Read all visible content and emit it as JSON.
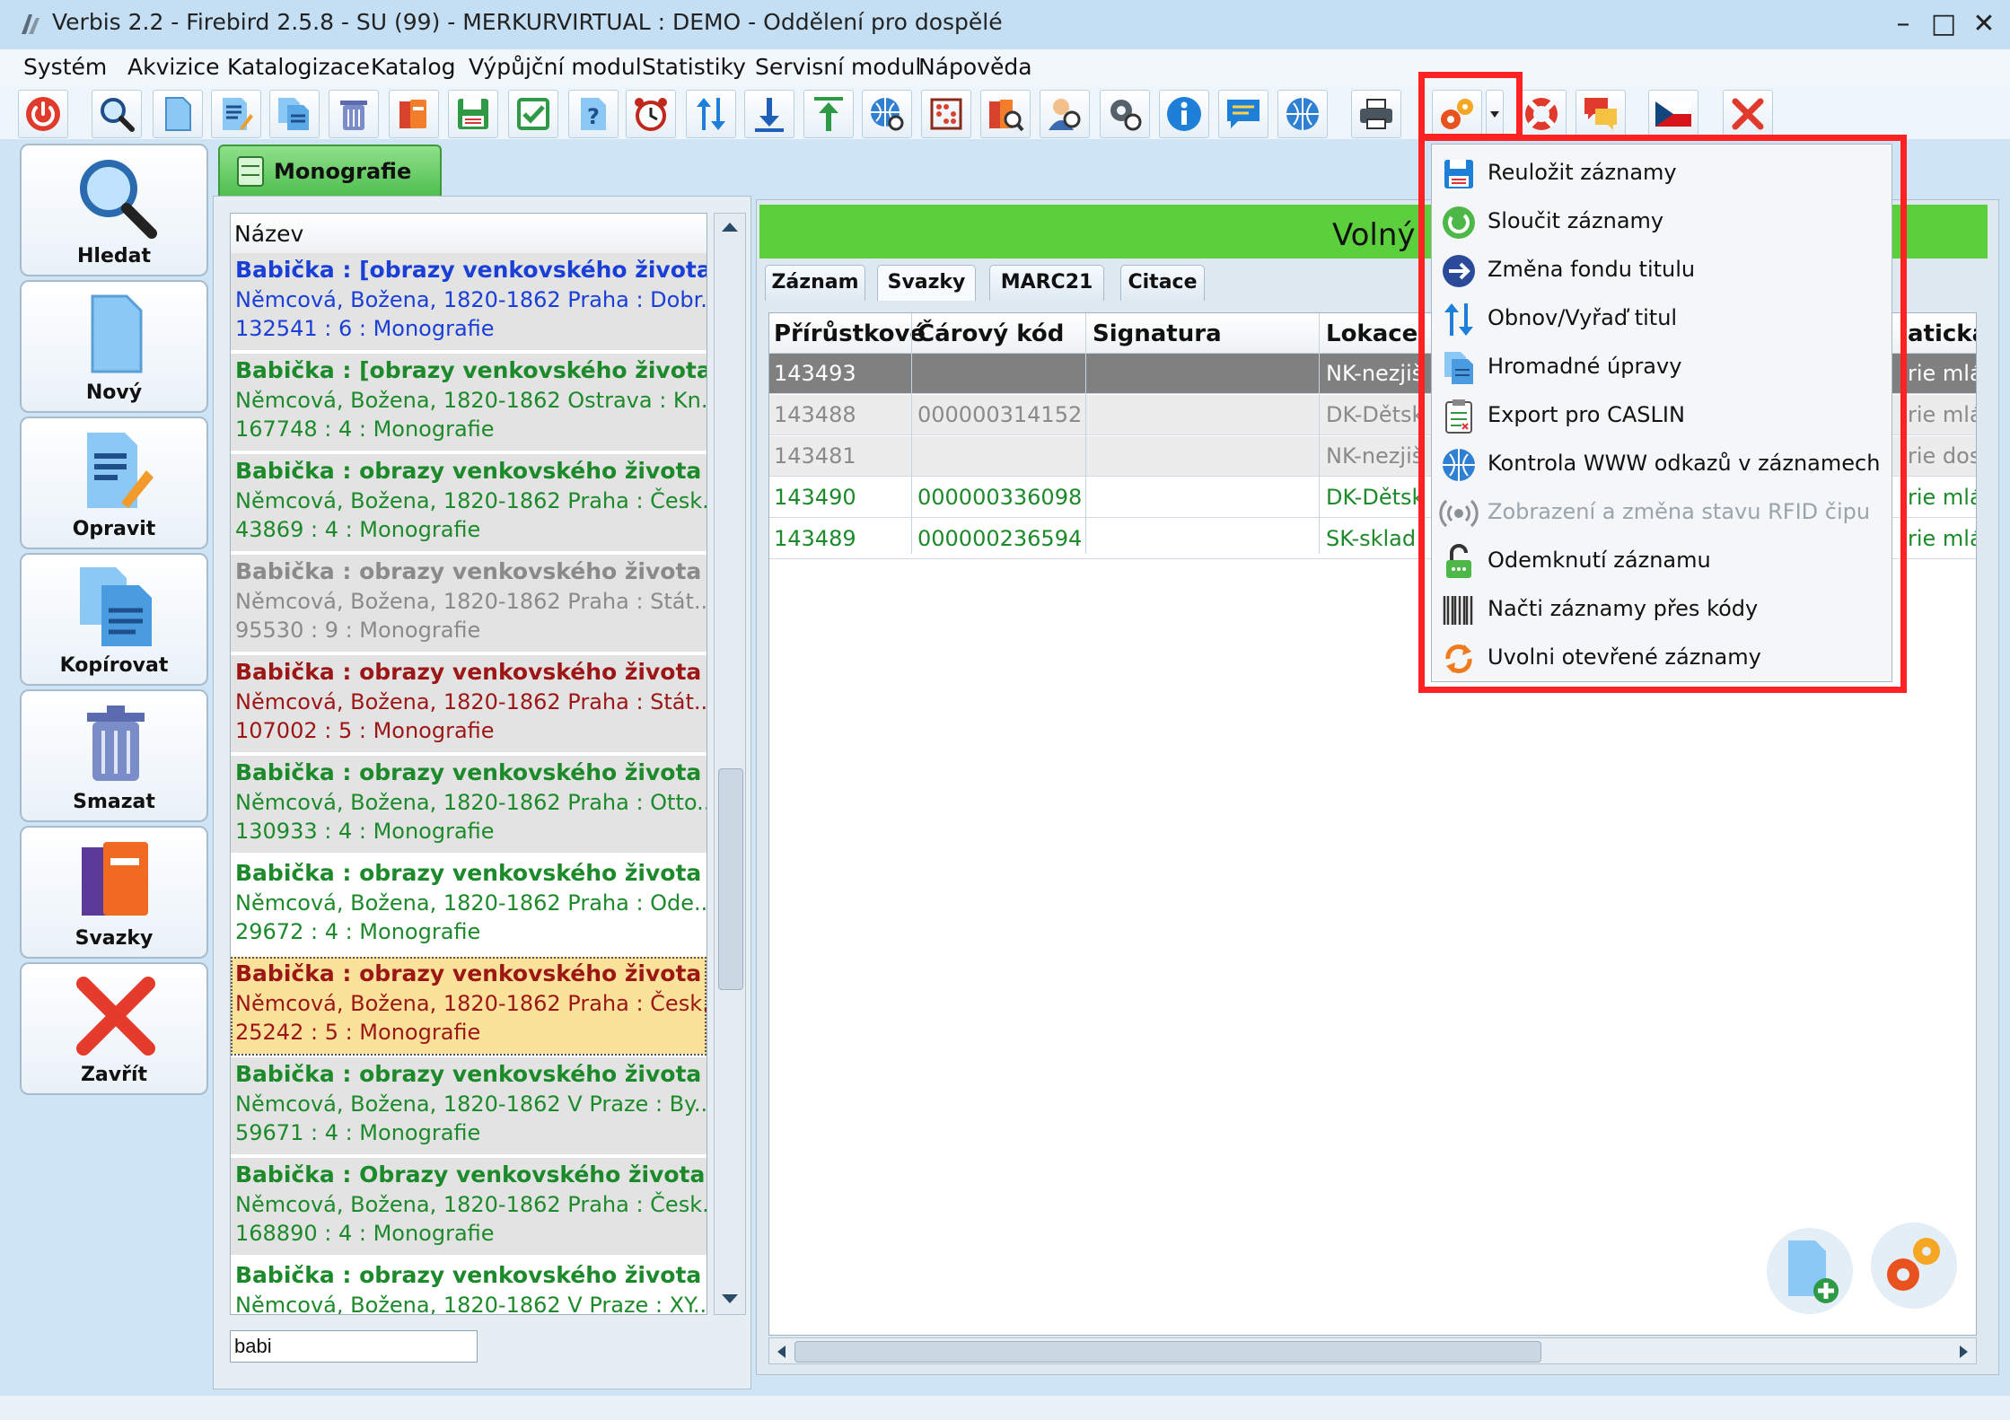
{
  "window": {
    "title": "Verbis 2.2 - Firebird 2.5.8 - SU (99) - MERKURVIRTUAL : DEMO - Oddělení pro dospělé",
    "controls": [
      "–",
      "□",
      "✕"
    ]
  },
  "menu": [
    "Systém",
    "Akvizice",
    "Katalogizace",
    "Katalog",
    "Výpůjční modul",
    "Statistiky",
    "Servisní modul",
    "Nápověda"
  ],
  "toolbar_icons": [
    "power-icon",
    "search-icon",
    "new-document-icon",
    "edit-document-icon",
    "copy-document-icon",
    "trash-icon",
    "books-icon",
    "save-icon",
    "checklist-icon",
    "help-document-icon",
    "alarm-clock-icon",
    "sort-arrows-icon",
    "download-icon",
    "upload-icon",
    "globe-search-icon",
    "abacus-icon",
    "book-search-icon",
    "user-search-icon",
    "gear-search-icon",
    "info-icon",
    "message-icon",
    "globe-icon",
    "printer-icon",
    "gears-icon",
    "dropdown-arrow-icon",
    "lifebuoy-icon",
    "chat-icon",
    "czech-flag-icon",
    "close-icon"
  ],
  "sidebar": [
    {
      "label": "Hledat",
      "icon": "search-icon"
    },
    {
      "label": "Nový",
      "icon": "new-document-icon"
    },
    {
      "label": "Opravit",
      "icon": "edit-document-icon"
    },
    {
      "label": "Kopírovat",
      "icon": "copy-document-icon"
    },
    {
      "label": "Smazat",
      "icon": "trash-icon"
    },
    {
      "label": "Svazky",
      "icon": "books-icon"
    },
    {
      "label": "Zavřít",
      "icon": "close-icon"
    }
  ],
  "module_tab": "Monografie",
  "list": {
    "header": "Název",
    "search_value": "babi",
    "records": [
      {
        "title": "Babička : [obrazy venkovského života...",
        "line2": "Němcová, Božena, 1820-1862 Praha : Dobr...",
        "line3": "132541 : 6 : Monografie",
        "color": "#1a3fd6",
        "bg": "#e3e3e3"
      },
      {
        "title": "Babička : [obrazy venkovského života...",
        "line2": "Němcová, Božena, 1820-1862 Ostrava : Kn...",
        "line3": "167748 : 4 : Monografie",
        "color": "#1c8a2a",
        "bg": "#e3e3e3"
      },
      {
        "title": "Babička : obrazy venkovského života ...",
        "line2": "Němcová, Božena, 1820-1862 Praha : Česk...",
        "line3": "43869 : 4 : Monografie",
        "color": "#1c8a2a",
        "bg": "#e3e3e3"
      },
      {
        "title": "Babička : obrazy venkovského života ...",
        "line2": "Němcová, Božena, 1820-1862 Praha : Stát...",
        "line3": "95530 : 9 : Monografie",
        "color": "#8a8a8a",
        "bg": "#e3e3e3"
      },
      {
        "title": "Babička : obrazy venkovského života ...",
        "line2": "Němcová, Božena, 1820-1862 Praha : Stát...",
        "line3": "107002 : 5 : Monografie",
        "color": "#9c1616",
        "bg": "#e3e3e3"
      },
      {
        "title": "Babička : obrazy venkovského života ...",
        "line2": "Němcová, Božena, 1820-1862 Praha : Otto...",
        "line3": "130933 : 4 : Monografie",
        "color": "#1c8a2a",
        "bg": "#e3e3e3"
      },
      {
        "title": "Babička : obrazy venkovského života ...",
        "line2": "Němcová, Božena, 1820-1862 Praha : Ode...",
        "line3": "29672 : 4 : Monografie",
        "color": "#1c8a2a",
        "bg": "#ffffff"
      },
      {
        "title": "Babička : obrazy venkovského života ...",
        "line2": "Němcová, Božena, 1820-1862 Praha : Česk...",
        "line3": "25242 : 5 : Monografie",
        "color": "#9c1616",
        "bg": "#fbe29a"
      },
      {
        "title": "Babička : obrazy venkovského života ...",
        "line2": "Němcová, Božena, 1820-1862 V Praze : By...",
        "line3": "59671 : 4 : Monografie",
        "color": "#1c8a2a",
        "bg": "#e3e3e3"
      },
      {
        "title": "Babička : Obrazy venkovského života ...",
        "line2": "Němcová, Božena, 1820-1862 Praha : Česk...",
        "line3": "168890 : 4 : Monografie",
        "color": "#1c8a2a",
        "bg": "#e3e3e3"
      },
      {
        "title": "Babička : obrazy venkovského života ...",
        "line2": "Němcová, Božena, 1820-1862 V Praze : XY...",
        "line3": "",
        "color": "#1c8a2a",
        "bg": "#ffffff"
      }
    ]
  },
  "detail": {
    "status": "Volný",
    "tabs": [
      "Záznam",
      "Svazky",
      "MARC21",
      "Citace"
    ],
    "columns": [
      "Přírůstkové",
      "Čárový kód",
      "Signatura",
      "Lokace",
      "atická"
    ],
    "rows": [
      {
        "acc": "143493",
        "barcode": "",
        "sig": "",
        "loc": "NK-nezjiš",
        "cat": "rie mlá",
        "color": "#ffffff",
        "bg": "#808080"
      },
      {
        "acc": "143488",
        "barcode": "000000314152",
        "sig": "",
        "loc": "DK-Dětsk",
        "cat": "rie mlá",
        "color": "#8a8a8a",
        "bg": "#ececec"
      },
      {
        "acc": "143481",
        "barcode": "",
        "sig": "",
        "loc": "NK-nezjiš",
        "cat": "rie dos",
        "color": "#8a8a8a",
        "bg": "#ececec"
      },
      {
        "acc": "143490",
        "barcode": "000000336098",
        "sig": "",
        "loc": "DK-Dětsk",
        "cat": "rie mlá",
        "color": "#1c8a2a",
        "bg": "#ffffff"
      },
      {
        "acc": "143489",
        "barcode": "000000236594",
        "sig": "",
        "loc": "SK-sklad",
        "cat": "rie mlá",
        "color": "#1c8a2a",
        "bg": "#ffffff"
      }
    ]
  },
  "popup_menu": [
    {
      "label": "Reuložit záznamy",
      "icon": "save-icon",
      "enabled": true
    },
    {
      "label": "Sloučit záznamy",
      "icon": "merge-icon",
      "enabled": true
    },
    {
      "label": "Změna fondu titulu",
      "icon": "arrow-right-icon",
      "enabled": true
    },
    {
      "label": "Obnov/Vyřaď titul",
      "icon": "sort-arrows-icon",
      "enabled": true
    },
    {
      "label": "Hromadné úpravy",
      "icon": "documents-icon",
      "enabled": true
    },
    {
      "label": "Export pro CASLIN",
      "icon": "clipboard-icon",
      "enabled": true
    },
    {
      "label": "Kontrola WWW odkazů v záznamech",
      "icon": "globe-icon",
      "enabled": true
    },
    {
      "label": "Zobrazení a změna stavu RFID čipu",
      "icon": "rfid-icon",
      "enabled": false
    },
    {
      "label": "Odemknutí záznamu",
      "icon": "unlock-icon",
      "enabled": true
    },
    {
      "label": "Načti záznamy přes kódy",
      "icon": "barcode-icon",
      "enabled": true
    },
    {
      "label": "Uvolni otevřené záznamy",
      "icon": "refresh-icon",
      "enabled": true
    }
  ],
  "colors": {
    "highlight": "#ff2222",
    "status_green": "#5bcf3c"
  }
}
